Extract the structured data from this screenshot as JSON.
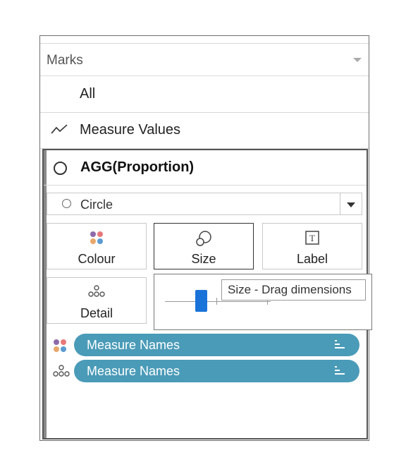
{
  "marks": {
    "title": "Marks",
    "cards": [
      {
        "label": "All"
      },
      {
        "label": "Measure Values",
        "icon": "line-chart-icon"
      }
    ],
    "active_card": {
      "title": "AGG(Proportion)",
      "mark_type": "Circle",
      "buttons": {
        "colour": "Colour",
        "size": "Size",
        "label": "Label",
        "detail": "Detail"
      },
      "size_popup": {
        "tooltip": "Size - Drag dimensions"
      },
      "pills": [
        {
          "label": "Measure Names",
          "encoding": "colour",
          "icon": "colour-dots-icon"
        },
        {
          "label": "Measure Names",
          "encoding": "detail",
          "icon": "detail-dots-icon"
        }
      ]
    }
  },
  "colors": {
    "pill": "#4a9bb8",
    "slider_thumb": "#1a73d9",
    "colour_dots": [
      "#8e6ba8",
      "#e8787a",
      "#e8a86a",
      "#5b9bd1"
    ]
  }
}
